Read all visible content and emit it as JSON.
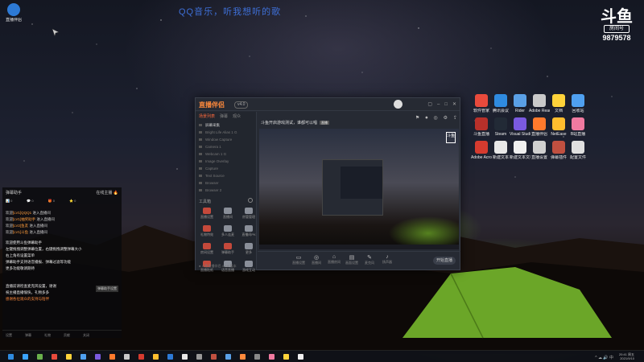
{
  "desktop": {
    "top_banner": "QQ音乐，听我想听的歌",
    "top_left_icon_label": "直播伴侣",
    "douyu": {
      "logo_glyph": "斗鱼",
      "room_label": "房间号",
      "room_id": "9879578"
    },
    "right_icons_row1": [
      "软件管家",
      "腾讯会议",
      "Rider",
      "Adobe Reader",
      "文档",
      "回收站"
    ],
    "right_icons_row2": [
      "斗鱼直播",
      "Steam",
      "Visual Studio",
      "直播伴侣",
      "NetEase",
      "B站直播"
    ],
    "right_icons_row3": [
      "Adobe Acrobat",
      "新建文本",
      "新建文本文档",
      "直播设置",
      "弹幕插件",
      "配置文件"
    ]
  },
  "app": {
    "name": "直播伴侣",
    "version": "v4.0",
    "window_controls": [
      "▢",
      "–",
      "□",
      "✕"
    ],
    "left_tabs": [
      "场景列表",
      "弹幕",
      "观众"
    ],
    "scenes": [
      {
        "name": "屏幕采集",
        "on": true
      },
      {
        "name": "Bright Life Alias 1 G",
        "on": false
      },
      {
        "name": "Window Capture",
        "on": false
      },
      {
        "name": "Camera 1",
        "on": false
      },
      {
        "name": "Webcam 1 G",
        "on": false
      },
      {
        "name": "Image Overlay",
        "on": false
      },
      {
        "name": "Capture",
        "on": false
      },
      {
        "name": "Text Source",
        "on": false
      },
      {
        "name": "Browser",
        "on": false
      },
      {
        "name": "Browser 2",
        "on": false
      }
    ],
    "tools_title": "工具箱",
    "tools": [
      {
        "label": "直播设置",
        "grey": false
      },
      {
        "label": "直播间",
        "grey": true
      },
      {
        "label": "房管管理",
        "grey": true
      },
      {
        "label": "礼物特效",
        "grey": false
      },
      {
        "label": "多人连麦",
        "grey": true
      },
      {
        "label": "直播间PK",
        "grey": true
      },
      {
        "label": "房间设置",
        "grey": false
      },
      {
        "label": "弹幕助手",
        "grey": false
      },
      {
        "label": "更多",
        "grey": true
      },
      {
        "label": "直播贴纸",
        "grey": false
      },
      {
        "label": "语音直播",
        "grey": true
      },
      {
        "label": "游戏互动",
        "grey": true
      }
    ],
    "left_bottom": "● 斗鱼直播伴侣 4.1.8 版本",
    "stream_title": "斗鱼开启游戏测试，谁都可以唱",
    "stream_tag": "直播",
    "sub_links": [
      "直播间标题设置",
      "直播信息设置"
    ],
    "head_icons": [
      "⚑",
      "⏺",
      "◎",
      "⚙",
      "⇪"
    ],
    "preview_logo": "斗鱼",
    "controls": [
      {
        "icon": "▭",
        "label": "直播设置"
      },
      {
        "icon": "◎",
        "label": "直播间"
      },
      {
        "icon": "⌂",
        "label": "直播房间"
      },
      {
        "icon": "▤",
        "label": "画面设置"
      },
      {
        "icon": "✎",
        "label": "麦克风"
      },
      {
        "icon": "♪",
        "label": "扬声器"
      }
    ],
    "start_label": "开始直播"
  },
  "chat": {
    "header_left": "弹幕助手",
    "header_right": "在线主播 🔥",
    "stats": [
      "📊 0",
      "💬 0",
      "🎁 0",
      "⭐ 0"
    ],
    "messages": [
      {
        "pre": "欢迎",
        "hl": "[LV1]QQQ1",
        "post": " 进入直播间",
        "style": "normal"
      },
      {
        "pre": "欢迎",
        "hl": "[LV1]抽奖助手",
        "post": " 进入直播间",
        "style": "normal"
      },
      {
        "pre": "欢迎",
        "hl": "[LV2]鱼友",
        "post": " 进入直播间",
        "style": "normal"
      },
      {
        "pre": "欢迎",
        "hl": "[LV1]斗鱼",
        "post": " 进入直播间",
        "style": "normal"
      }
    ],
    "notices": [
      "欢迎使用斗鱼弹幕助手",
      "左键拖拽调整弹幕位置，右键拖拽调整弹幕大小",
      "右上角有设置菜单",
      "弹幕助手支持语音播报、弹幕过滤等功能",
      "更多功能敬请期待"
    ],
    "tag": "弹幕助手设置",
    "tips": [
      {
        "text": "直播前请检查麦克风设置，谢谢",
        "style": "white"
      },
      {
        "text": "祝主播直播愉快，礼物多多",
        "style": "white"
      },
      {
        "text": "感谢各位观众的支持与陪伴",
        "style": "orange"
      }
    ],
    "footer": [
      "设置",
      "弹幕",
      "礼物",
      "贡献",
      "关闭"
    ]
  },
  "taskbar": {
    "tray": "^ ☁ 🔊 中",
    "time": "20:41 周五",
    "date": "2021/9/10"
  }
}
